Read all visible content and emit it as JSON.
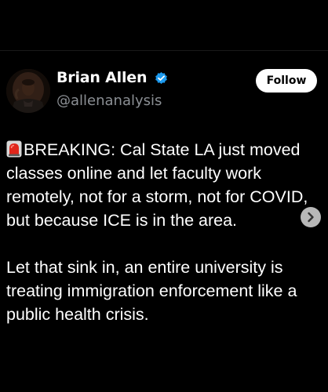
{
  "post": {
    "author": {
      "display_name": "Brian Allen",
      "handle": "@allenanalysis",
      "verified": true,
      "verified_badge_color": "#1d9bf0"
    },
    "follow_label": "Follow",
    "body": {
      "emoji": "siren-icon",
      "paragraph_1": "BREAKING: Cal State LA just moved classes online and let faculty work remotely, not for a storm, not for COVID, but because ICE is in the area.",
      "paragraph_2": "Let that sink in, an entire university is treating immigration enforcement like a public health crisis."
    }
  },
  "carousel": {
    "next_icon": "chevron-right-icon"
  },
  "theme": {
    "background": "#000000",
    "text": "#ffffff",
    "secondary_text": "#8b8f94",
    "button_bg": "#ffffff",
    "button_text": "#000000"
  }
}
